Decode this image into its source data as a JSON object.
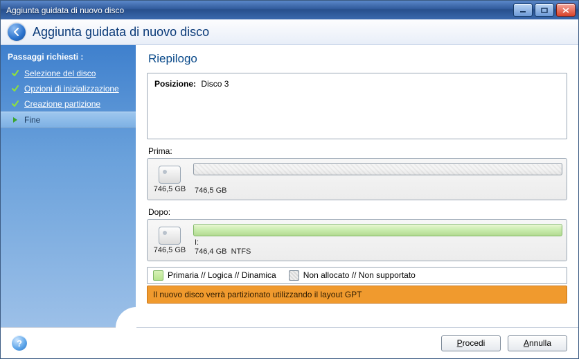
{
  "window": {
    "title": "Aggiunta guidata di nuovo disco"
  },
  "header": {
    "title": "Aggiunta guidata di nuovo disco"
  },
  "sidebar": {
    "heading": "Passaggi richiesti :",
    "steps": [
      {
        "label": "Selezione del disco",
        "state": "done"
      },
      {
        "label": "Opzioni di inizializzazione",
        "state": "done"
      },
      {
        "label": "Creazione partizione",
        "state": "done"
      },
      {
        "label": "Fine",
        "state": "current"
      }
    ]
  },
  "main": {
    "page_title": "Riepilogo",
    "position_label": "Posizione:",
    "position_value": "Disco 3",
    "before_label": "Prima:",
    "after_label": "Dopo:",
    "disk_total": "746,5 GB",
    "before_partition_text": "\n746,5 GB",
    "after_partition_text": "I:\n746,4 GB  NTFS",
    "legend_primary": "Primaria // Logica // Dinamica",
    "legend_unalloc": "Non allocato // Non supportato",
    "warning": "Il nuovo disco verrà partizionato utilizzando il layout GPT"
  },
  "footer": {
    "proceed_html": "<u>P</u>rocedi",
    "cancel_html": "<u>A</u>nnulla"
  }
}
